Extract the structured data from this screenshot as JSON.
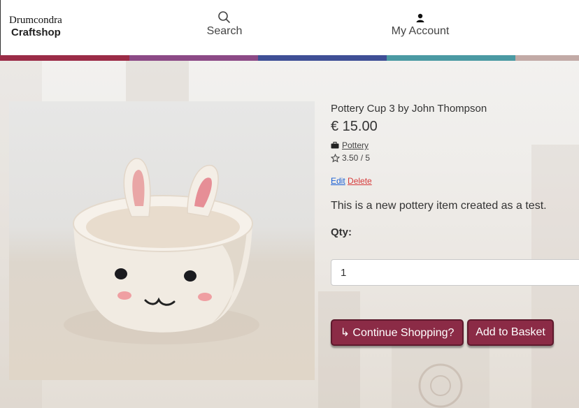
{
  "brand": {
    "line1": "Drumcondra",
    "line2": "Craftshop"
  },
  "nav": {
    "search_label": "Search",
    "account_label": "My Account"
  },
  "colorbar": [
    "#9b2c47",
    "#8c4a86",
    "#3f4f96",
    "#4b9aa3",
    "#c2aaa6"
  ],
  "product": {
    "title": "Pottery Cup 3 by John Thompson",
    "price": "€ 15.00",
    "category": "Pottery",
    "rating": "3.50 / 5",
    "edit_label": "Edit",
    "delete_label": "Delete",
    "description": "This is a new pottery item created as a test.",
    "qty_label": "Qty:",
    "qty_value": "1"
  },
  "buttons": {
    "continue_label": "↳ Continue Shopping?",
    "basket_label": "Add to Basket"
  },
  "colors": {
    "accent": "#8b2b46"
  }
}
